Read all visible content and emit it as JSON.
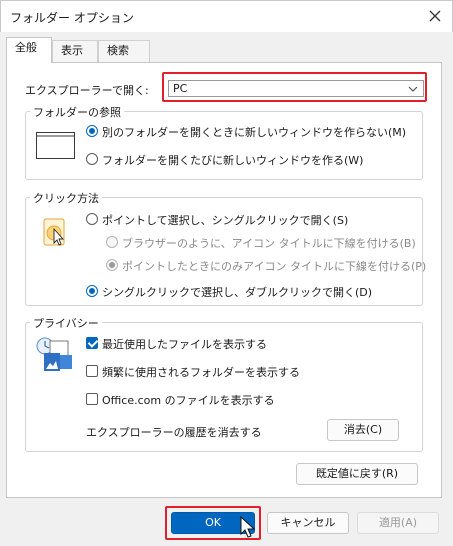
{
  "window": {
    "title": "フォルダー オプション"
  },
  "tabs": [
    {
      "label": "全般",
      "active": true
    },
    {
      "label": "表示",
      "active": false
    },
    {
      "label": "検索",
      "active": false
    }
  ],
  "open_explorer": {
    "label": "エクスプローラーで開く:",
    "selected": "PC"
  },
  "browse_folders": {
    "title": "フォルダーの参照",
    "options": [
      {
        "label": "別のフォルダーを開くときに新しいウィンドウを作らない(M)",
        "checked": true
      },
      {
        "label": "フォルダーを開くたびに新しいウィンドウを作る(W)",
        "checked": false
      }
    ]
  },
  "click_method": {
    "title": "クリック方法",
    "options": [
      {
        "label": "ポイントして選択し、シングルクリックで開く(S)",
        "checked": false,
        "enabled": true
      },
      {
        "label": "ブラウザーのように、アイコン タイトルに下線を付ける(B)",
        "checked": false,
        "enabled": false
      },
      {
        "label": "ポイントしたときにのみアイコン タイトルに下線を付ける(P)",
        "checked": true,
        "enabled": false
      },
      {
        "label": "シングルクリックで選択し、ダブルクリックで開く(D)",
        "checked": true,
        "enabled": true
      }
    ]
  },
  "privacy": {
    "title": "プライバシー",
    "options": [
      {
        "label": "最近使用したファイルを表示する",
        "checked": true
      },
      {
        "label": "頻繁に使用されるフォルダーを表示する",
        "checked": false
      },
      {
        "label": "Office.com のファイルを表示する",
        "checked": false
      }
    ],
    "clear_history_label": "エクスプローラーの履歴を消去する",
    "clear_button": "消去(C)"
  },
  "restore_defaults_button": "既定値に戻す(R)",
  "footer": {
    "ok": "OK",
    "cancel": "キャンセル",
    "apply": "適用(A)"
  },
  "colors": {
    "accent": "#0067c0",
    "highlight_box": "#e0202a"
  }
}
